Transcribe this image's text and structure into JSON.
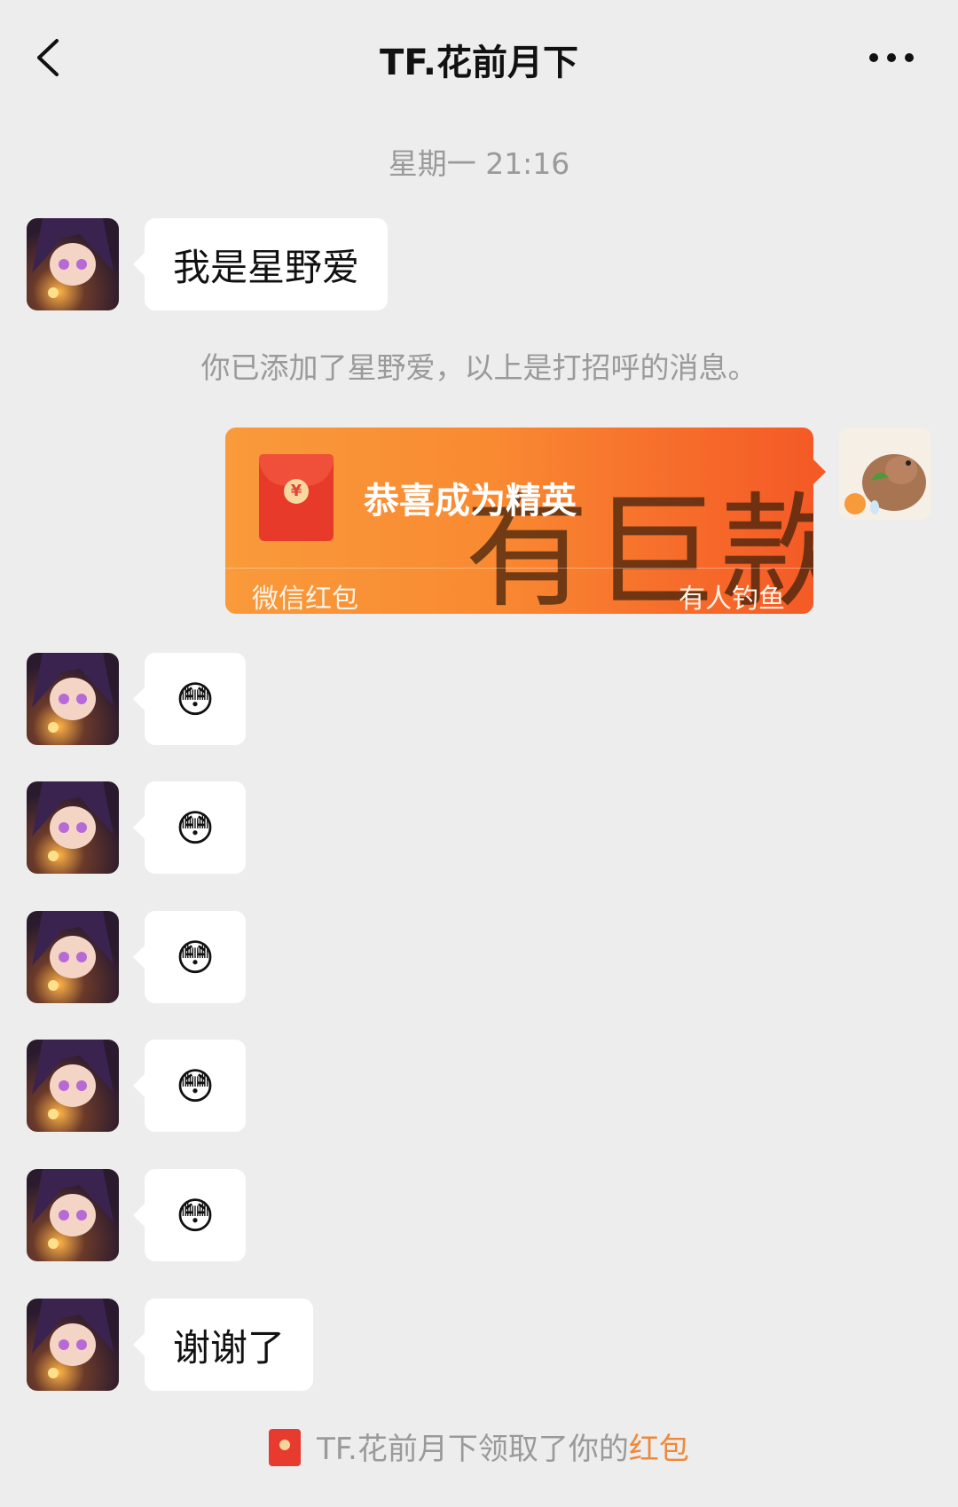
{
  "header": {
    "title": "TF.花前月下",
    "back_icon": "chevron-left-icon",
    "more_icon": "more-dots-icon"
  },
  "timestamp": "星期一 21:16",
  "messages": {
    "greeting": "我是星野爱",
    "system_notice": "你已添加了星野爱，以上是打招呼的消息。",
    "emoji_glyph": "😳",
    "thanks": "谢谢了"
  },
  "red_packet": {
    "title": "恭喜成为精英",
    "watermark": "有巨款",
    "label": "微信红包",
    "subtitle": "有人钓鱼",
    "coin": "¥",
    "colors": {
      "start": "#f99a3b",
      "end": "#f45a26"
    }
  },
  "claim_notice": {
    "prefix": "TF.花前月下领取了你的",
    "highlight": "红包"
  }
}
